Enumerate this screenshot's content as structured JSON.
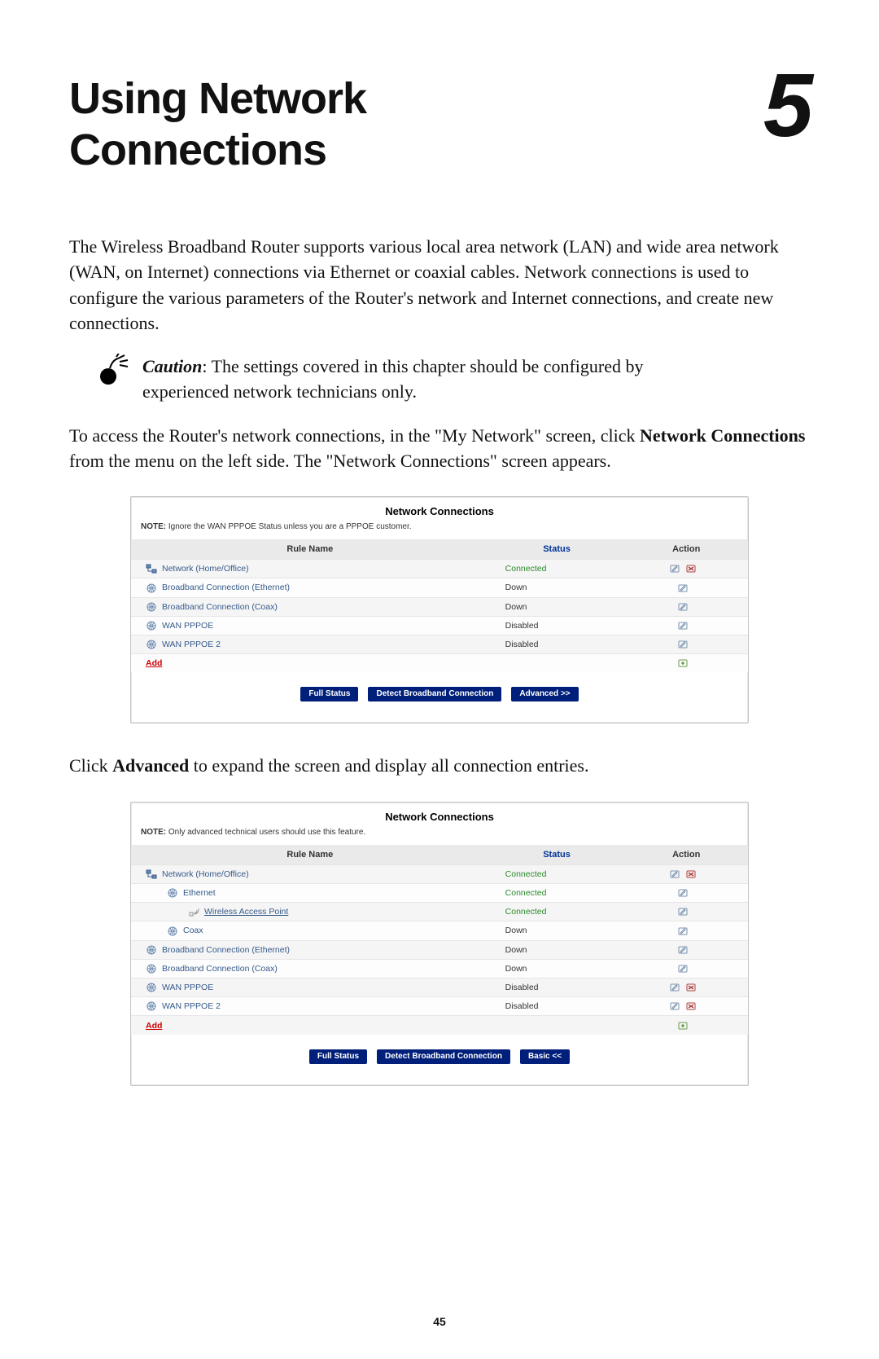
{
  "chapter": {
    "title_line1": "Using Network",
    "title_line2": "Connections",
    "number": "5"
  },
  "intro": "The Wireless Broadband Router supports various local area network (LAN) and wide area network (WAN, on Internet) connections via Ethernet or coaxial cables. Network connections is used to configure the various parameters of the Router's network and Internet connections, and create new connections.",
  "caution": {
    "label": "Caution",
    "text": ": The settings covered in this chapter should be configured by experienced network technicians only."
  },
  "para_access_pre": "To access the Router's network connections, in the \"My Network\" screen, click ",
  "para_access_bold": "Network Connections",
  "para_access_post": " from the menu on the left side. The \"Network Connections\" screen appears.",
  "shot1": {
    "title": "Network Connections",
    "note_bold": "NOTE:",
    "note": " Ignore the WAN PPPOE Status unless you are a PPPOE customer.",
    "headers": {
      "rule": "Rule Name",
      "status": "Status",
      "action": "Action"
    },
    "rows": [
      {
        "icon": "net",
        "indent": 0,
        "name": "Network (Home/Office)",
        "status": "Connected",
        "status_green": true,
        "actions": "edit-delete"
      },
      {
        "icon": "globe",
        "indent": 0,
        "name": "Broadband Connection (Ethernet)",
        "status": "Down",
        "status_green": false,
        "actions": "edit"
      },
      {
        "icon": "globe",
        "indent": 0,
        "name": "Broadband Connection (Coax)",
        "status": "Down",
        "status_green": false,
        "actions": "edit"
      },
      {
        "icon": "globe",
        "indent": 0,
        "name": "WAN PPPOE",
        "status": "Disabled",
        "status_green": false,
        "actions": "edit"
      },
      {
        "icon": "globe",
        "indent": 0,
        "name": "WAN PPPOE 2",
        "status": "Disabled",
        "status_green": false,
        "actions": "edit"
      }
    ],
    "add": "Add",
    "buttons": [
      "Full Status",
      "Detect Broadband Connection",
      "Advanced >>"
    ]
  },
  "mid_para_pre": "Click ",
  "mid_para_bold": "Advanced",
  "mid_para_post": " to expand the screen and display all connection entries.",
  "shot2": {
    "title": "Network Connections",
    "note_bold": "NOTE:",
    "note": " Only advanced technical users should use this feature.",
    "headers": {
      "rule": "Rule Name",
      "status": "Status",
      "action": "Action"
    },
    "rows": [
      {
        "icon": "net",
        "indent": 0,
        "name": "Network (Home/Office)",
        "underline": false,
        "status": "Connected",
        "status_green": true,
        "actions": "edit-delete"
      },
      {
        "icon": "globe",
        "indent": 1,
        "name": "Ethernet",
        "underline": false,
        "status": "Connected",
        "status_green": true,
        "actions": "edit"
      },
      {
        "icon": "wifi",
        "indent": 2,
        "name": "Wireless Access Point",
        "underline": true,
        "status": "Connected",
        "status_green": true,
        "actions": "edit"
      },
      {
        "icon": "globe",
        "indent": 1,
        "name": "Coax",
        "underline": false,
        "status": "Down",
        "status_green": false,
        "actions": "edit"
      },
      {
        "icon": "globe",
        "indent": 0,
        "name": "Broadband Connection (Ethernet)",
        "underline": false,
        "status": "Down",
        "status_green": false,
        "actions": "edit"
      },
      {
        "icon": "globe",
        "indent": 0,
        "name": "Broadband Connection (Coax)",
        "underline": false,
        "status": "Down",
        "status_green": false,
        "actions": "edit"
      },
      {
        "icon": "globe",
        "indent": 0,
        "name": "WAN PPPOE",
        "underline": false,
        "status": "Disabled",
        "status_green": false,
        "actions": "edit-delete"
      },
      {
        "icon": "globe",
        "indent": 0,
        "name": "WAN PPPOE 2",
        "underline": false,
        "status": "Disabled",
        "status_green": false,
        "actions": "edit-delete"
      }
    ],
    "add": "Add",
    "buttons": [
      "Full  Status",
      "Detect Broadband Connection",
      "Basic <<"
    ]
  },
  "page_number": "45"
}
